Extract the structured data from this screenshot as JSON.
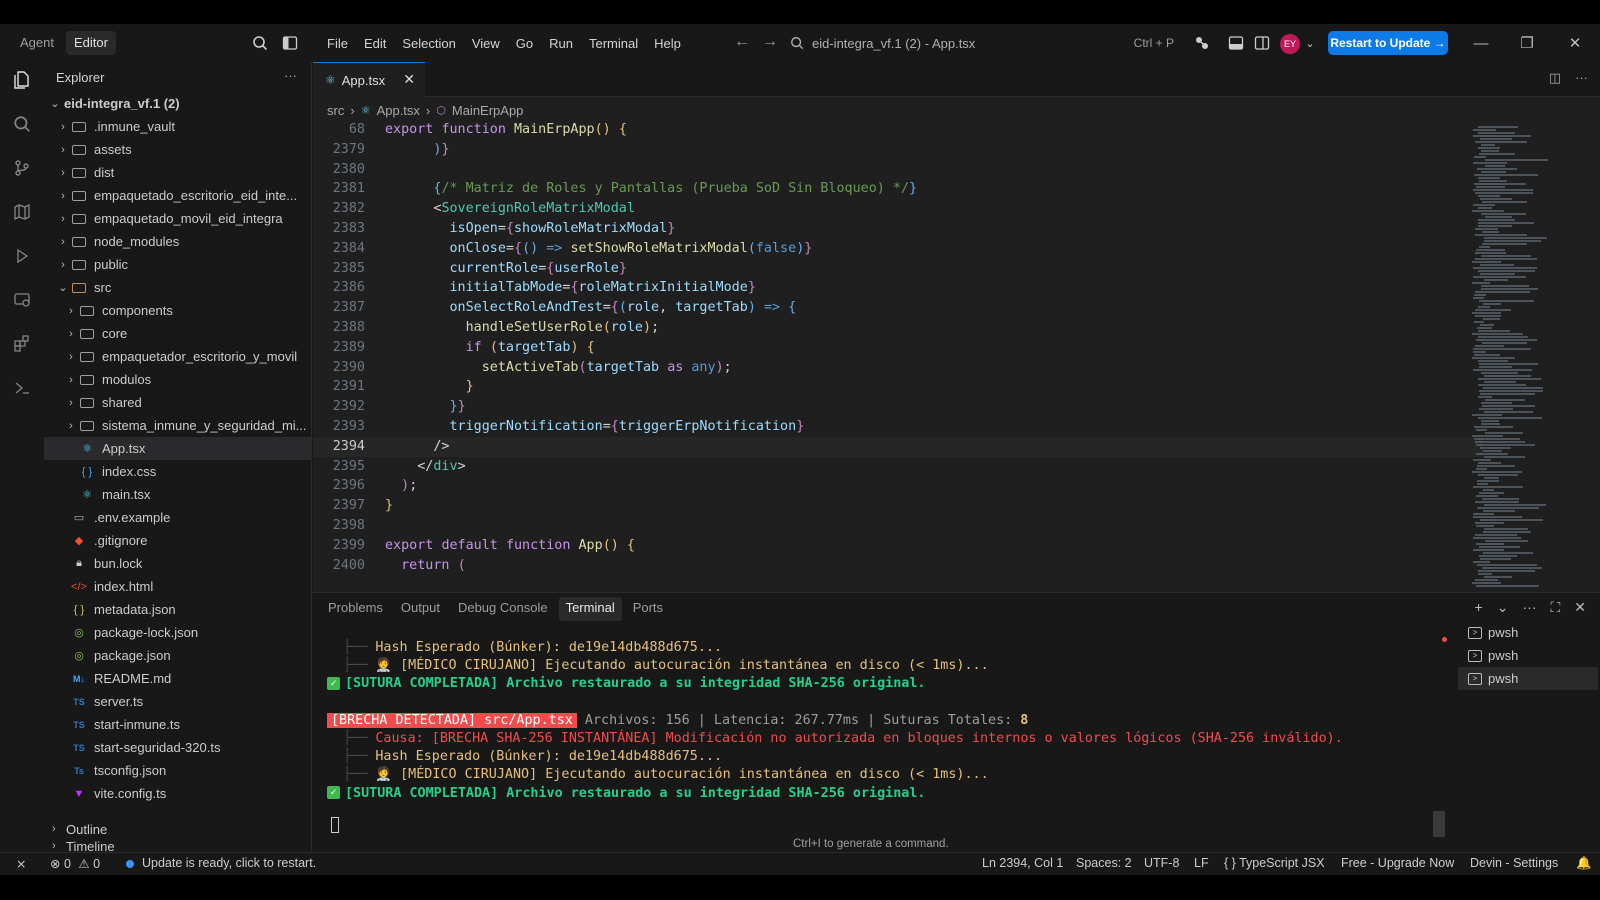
{
  "titlebar": {
    "modes": [
      "Agent",
      "Editor"
    ],
    "active_mode": "Editor",
    "menu": [
      "File",
      "Edit",
      "Selection",
      "View",
      "Go",
      "Run",
      "Terminal",
      "Help"
    ],
    "command_center": "eid-integra_vf.1 (2) - App.tsx",
    "command_shortcut": "Ctrl + P",
    "avatar_initials": "EY",
    "restart_label": "Restart to Update →"
  },
  "sidebar": {
    "title": "Explorer",
    "root": "eid-integra_vf.1 (2)",
    "items": [
      {
        "label": ".inmune_vault",
        "depth": 1,
        "type": "folder"
      },
      {
        "label": "assets",
        "depth": 1,
        "type": "folder"
      },
      {
        "label": "dist",
        "depth": 1,
        "type": "folder"
      },
      {
        "label": "empaquetado_escritorio_eid_inte...",
        "depth": 1,
        "type": "folder"
      },
      {
        "label": "empaquetado_movil_eid_integra",
        "depth": 1,
        "type": "folder"
      },
      {
        "label": "node_modules",
        "depth": 1,
        "type": "folder"
      },
      {
        "label": "public",
        "depth": 1,
        "type": "folder"
      },
      {
        "label": "src",
        "depth": 1,
        "type": "folder-open"
      },
      {
        "label": "components",
        "depth": 2,
        "type": "folder"
      },
      {
        "label": "core",
        "depth": 2,
        "type": "folder"
      },
      {
        "label": "empaquetador_escritorio_y_movil",
        "depth": 2,
        "type": "folder"
      },
      {
        "label": "modulos",
        "depth": 2,
        "type": "folder"
      },
      {
        "label": "shared",
        "depth": 2,
        "type": "folder"
      },
      {
        "label": "sistema_inmune_y_seguridad_mi...",
        "depth": 2,
        "type": "folder"
      },
      {
        "label": "App.tsx",
        "depth": 2,
        "type": "react",
        "selected": true
      },
      {
        "label": "index.css",
        "depth": 2,
        "type": "css"
      },
      {
        "label": "main.tsx",
        "depth": 2,
        "type": "react"
      },
      {
        "label": ".env.example",
        "depth": 1,
        "type": "file"
      },
      {
        "label": ".gitignore",
        "depth": 1,
        "type": "git"
      },
      {
        "label": "bun.lock",
        "depth": 1,
        "type": "lock"
      },
      {
        "label": "index.html",
        "depth": 1,
        "type": "html"
      },
      {
        "label": "metadata.json",
        "depth": 1,
        "type": "json"
      },
      {
        "label": "package-lock.json",
        "depth": 1,
        "type": "npm"
      },
      {
        "label": "package.json",
        "depth": 1,
        "type": "npm"
      },
      {
        "label": "README.md",
        "depth": 1,
        "type": "md"
      },
      {
        "label": "server.ts",
        "depth": 1,
        "type": "ts"
      },
      {
        "label": "start-inmune.ts",
        "depth": 1,
        "type": "ts"
      },
      {
        "label": "start-seguridad-320.ts",
        "depth": 1,
        "type": "ts"
      },
      {
        "label": "tsconfig.json",
        "depth": 1,
        "type": "tsconfig"
      },
      {
        "label": "vite.config.ts",
        "depth": 1,
        "type": "vite"
      }
    ],
    "outline": "Outline",
    "timeline": "Timeline"
  },
  "editor": {
    "tab": "App.tsx",
    "breadcrumb": [
      "src",
      "App.tsx",
      "MainErpApp"
    ],
    "current_line": "2394",
    "lines": [
      {
        "n": "68",
        "indent": 0,
        "html": "<span class='kw'>export</span> <span class='kw'>function</span> <span class='fn'>MainErpApp</span><span class='br'>()</span> <span class='br'>{</span>"
      },
      {
        "n": "2379",
        "indent": 6,
        "html": "<span class='br3'>)</span><span class='br2'>}</span>"
      },
      {
        "n": "2380",
        "indent": 0,
        "html": ""
      },
      {
        "n": "2381",
        "indent": 6,
        "html": "<span class='br3'>{</span><span class='cm'>/* Matriz de Roles y Pantallas (Prueba SoD Sin Bloqueo) */</span><span class='br3'>}</span>"
      },
      {
        "n": "2382",
        "indent": 6,
        "html": "<span class='op'>&lt;</span><span class='tag'>SovereignRoleMatrixModal</span>"
      },
      {
        "n": "2383",
        "indent": 8,
        "html": "<span class='attr'>isOpen</span><span class='op'>=</span><span class='br2'>{</span><span class='var'>showRoleMatrixModal</span><span class='br2'>}</span>"
      },
      {
        "n": "2384",
        "indent": 8,
        "html": "<span class='attr'>onClose</span><span class='op'>=</span><span class='br2'>{</span><span class='br3'>()</span> <span class='kw2'>=&gt;</span> <span class='fn'>setShowRoleMatrixModal</span><span class='br3'>(</span><span class='kw2'>false</span><span class='br3'>)</span><span class='br2'>}</span>"
      },
      {
        "n": "2385",
        "indent": 8,
        "html": "<span class='attr'>currentRole</span><span class='op'>=</span><span class='br2'>{</span><span class='var'>userRole</span><span class='br2'>}</span>"
      },
      {
        "n": "2386",
        "indent": 8,
        "html": "<span class='attr'>initialTabMode</span><span class='op'>=</span><span class='br2'>{</span><span class='var'>roleMatrixInitialMode</span><span class='br2'>}</span>"
      },
      {
        "n": "2387",
        "indent": 8,
        "html": "<span class='attr'>onSelectRoleAndTest</span><span class='op'>=</span><span class='br2'>{</span><span class='br3'>(</span><span class='var'>role</span>, <span class='var'>targetTab</span><span class='br3'>)</span> <span class='kw2'>=&gt;</span> <span class='br3'>{</span>"
      },
      {
        "n": "2388",
        "indent": 10,
        "html": "<span class='fn'>handleSetUserRole</span><span class='br'>(</span><span class='var'>role</span><span class='br'>)</span>;"
      },
      {
        "n": "2389",
        "indent": 10,
        "html": "<span class='kw'>if</span> <span class='br'>(</span><span class='var'>targetTab</span><span class='br'>)</span> <span class='br'>{</span>"
      },
      {
        "n": "2390",
        "indent": 12,
        "html": "<span class='fn'>setActiveTab</span><span class='br2'>(</span><span class='var'>targetTab</span> <span class='kw'>as</span> <span class='kw2'>any</span><span class='br2'>)</span>;"
      },
      {
        "n": "2391",
        "indent": 10,
        "html": "<span class='br'>}</span>"
      },
      {
        "n": "2392",
        "indent": 8,
        "html": "<span class='br3'>}</span><span class='br2'>}</span>"
      },
      {
        "n": "2393",
        "indent": 8,
        "html": "<span class='attr'>triggerNotification</span><span class='op'>=</span><span class='br2'>{</span><span class='var'>triggerErpNotification</span><span class='br2'>}</span>"
      },
      {
        "n": "2394",
        "indent": 6,
        "html": "<span class='op'>/&gt;</span>"
      },
      {
        "n": "2395",
        "indent": 4,
        "html": "<span class='op'>&lt;/</span><span class='tag'>div</span><span class='op'>&gt;</span>"
      },
      {
        "n": "2396",
        "indent": 2,
        "html": "<span class='br2'>)</span>;"
      },
      {
        "n": "2397",
        "indent": 0,
        "html": "<span class='br'>}</span>"
      },
      {
        "n": "2398",
        "indent": 0,
        "html": ""
      },
      {
        "n": "2399",
        "indent": 0,
        "html": "<span class='kw'>export</span> <span class='kw'>default</span> <span class='kw'>function</span> <span class='fn'>App</span><span class='br'>()</span> <span class='br'>{</span>"
      },
      {
        "n": "2400",
        "indent": 2,
        "html": "<span class='kw'>return</span> <span class='br2'>(</span>"
      }
    ]
  },
  "panel": {
    "tabs": [
      "Problems",
      "Output",
      "Debug Console",
      "Terminal",
      "Ports"
    ],
    "active_tab": "Terminal",
    "terminal_lines": [
      {
        "kind": "sub",
        "text": "Hash Esperado (Búnker): de19e14db488d675..."
      },
      {
        "kind": "heal",
        "text": "[MÉDICO CIRUJANO] Ejecutando autocuración instantánea en disco (< 1ms)..."
      },
      {
        "kind": "ok",
        "text": "[SUTURA COMPLETADA] Archivo restaurado a su integridad SHA-256 original."
      },
      {
        "kind": "blank",
        "text": ""
      },
      {
        "kind": "breach",
        "badge": "[BRECHA DETECTADA] src/App.tsx",
        "stats": "Archivos: 156 | Latencia: 267.77ms | Suturas Totales: ",
        "count": "8"
      },
      {
        "kind": "cause",
        "text": "Causa: [BRECHA SHA-256 INSTANTÁNEA] Modificación no autorizada en bloques internos o valores lógicos (SHA-256 inválido)."
      },
      {
        "kind": "sub",
        "text": "Hash Esperado (Búnker): de19e14db488d675..."
      },
      {
        "kind": "heal",
        "text": "[MÉDICO CIRUJANO] Ejecutando autocuración instantánea en disco (< 1ms)..."
      },
      {
        "kind": "ok",
        "text": "[SUTURA COMPLETADA] Archivo restaurado a su integridad SHA-256 original."
      }
    ],
    "hint": "Ctrl+I to generate a command.",
    "terminals": [
      "pwsh",
      "pwsh",
      "pwsh"
    ]
  },
  "statusbar": {
    "errors": "0",
    "warnings": "0",
    "update_msg": "Update is ready, click to restart.",
    "position": "Ln 2394, Col 1",
    "spaces": "Spaces: 2",
    "encoding": "UTF-8",
    "eol": "LF",
    "language": "TypeScript JSX",
    "plan": "Free - Upgrade Now",
    "settings": "Devin - Settings"
  }
}
